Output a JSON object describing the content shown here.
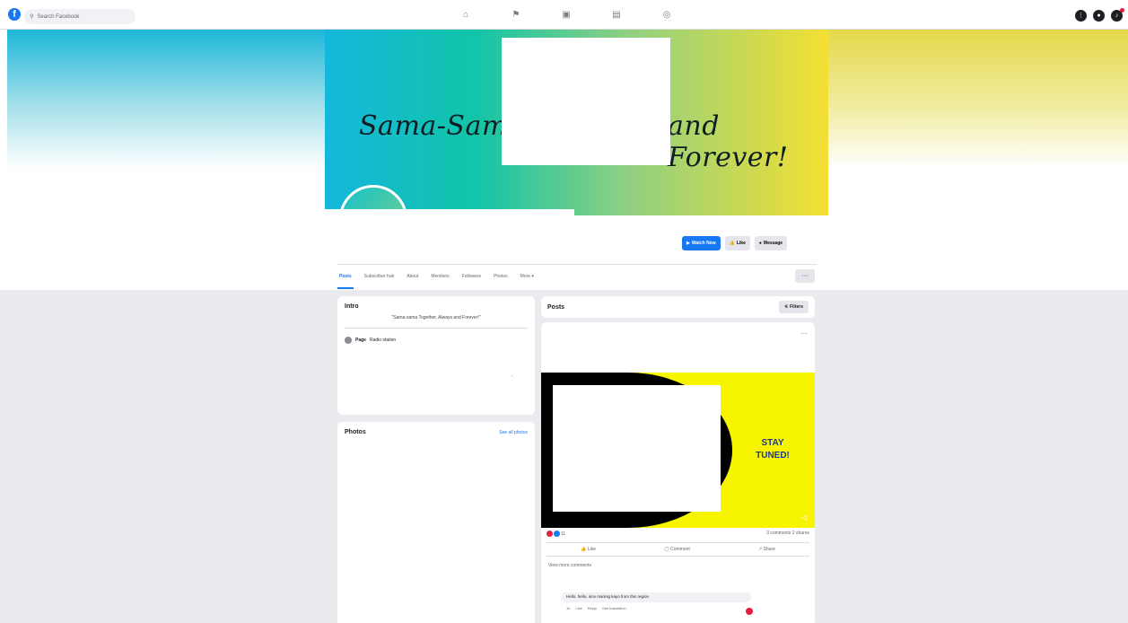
{
  "topbar": {
    "logo": "f",
    "search_placeholder": "Search Facebook",
    "nav_icons": [
      "home-icon",
      "flag-icon",
      "video-icon",
      "store-icon",
      "gaming-icon"
    ],
    "right_icons": [
      "menu-icon",
      "messenger-icon",
      "notifications-icon"
    ]
  },
  "cover": {
    "script_left": "Sama-Sama",
    "script_right": "and Forever!",
    "gradient": [
      "#14b8dd",
      "#12c4a8",
      "#8fd081",
      "#f4df33"
    ]
  },
  "actions": {
    "watch_now": "Watch Now",
    "like": "Like",
    "message": "Message"
  },
  "tabs": [
    "Posts",
    "Subscriber hub",
    "About",
    "Mentions",
    "Followers",
    "Photos",
    "More ▾"
  ],
  "more_button": "···",
  "intro": {
    "title": "Intro",
    "bio": "\"Sama-sama Together, Always and Forever!\"",
    "page_label": "Page",
    "page_category": "Radio station"
  },
  "photos": {
    "title": "Photos",
    "see_all": "See all photos"
  },
  "posts": {
    "title": "Posts",
    "filters": "Filters",
    "media_text_line1": "STAY",
    "media_text_line2": "TUNED!",
    "reaction_count": "11",
    "comments": "3 comments",
    "shares": "2 shares",
    "like": "Like",
    "comment": "Comment",
    "share": "Share",
    "view_more": "View more comments",
    "comment_text": "Hello, hello, nice marinig kayo from this region",
    "comment_meta": [
      "1h",
      "Like",
      "Reply",
      "See translation"
    ]
  },
  "colors": {
    "brand": "#1877f2",
    "page_bg": "#e9ebee",
    "media_yellow": "#f7f400"
  }
}
